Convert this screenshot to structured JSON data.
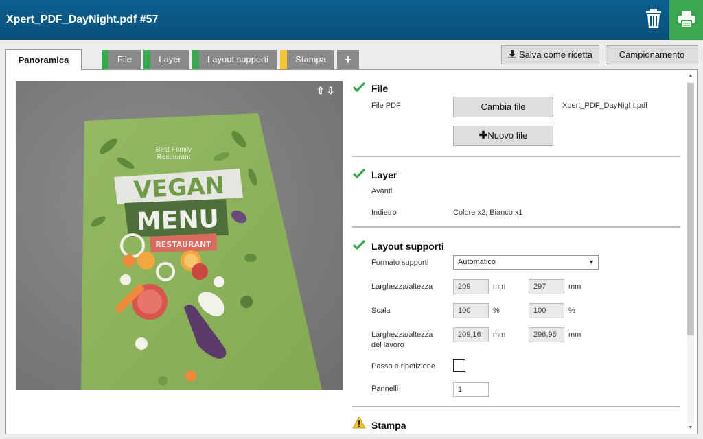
{
  "header": {
    "title": "Xpert_PDF_DayNight.pdf #57"
  },
  "tabs": [
    {
      "label": "Panoramica",
      "active": true
    },
    {
      "label": "File",
      "color": "#3aa84e"
    },
    {
      "label": "Layer",
      "color": "#3aa84e"
    },
    {
      "label": "Layout supporti",
      "color": "#3aa84e"
    },
    {
      "label": "Stampa",
      "color": "#f4c531"
    },
    {
      "label": "+"
    }
  ],
  "actions": {
    "save_recipe": "Salva come ricetta",
    "sampling": "Campionamento"
  },
  "preview": {
    "brand_line1": "Best Family",
    "brand_line2": "Restaurant",
    "word1": "VEGAN",
    "word2": "MENU",
    "word3": "RESTAURANT",
    "arrows": "⇧⇩"
  },
  "file_section": {
    "title": "File",
    "pdf_label": "File PDF",
    "change_button": "Cambia file",
    "filename": "Xpert_PDF_DayNight.pdf",
    "new_button": "Nuovo file"
  },
  "layer_section": {
    "title": "Layer",
    "front_label": "Avanti",
    "back_label": "Indietro",
    "back_value": "Colore x2, Bianco x1"
  },
  "layout_section": {
    "title": "Layout supporti",
    "format_label": "Formato supporti",
    "format_value": "Automatico",
    "size_label": "Larghezza/altezza",
    "width": "209",
    "height": "297",
    "unit_mm": "mm",
    "scale_label": "Scala",
    "scale_x": "100",
    "scale_y": "100",
    "unit_pct": "%",
    "job_size_label_1": "Larghezza/altezza",
    "job_size_label_2": "del lavoro",
    "job_width": "209,16",
    "job_height": "296,96",
    "step_repeat_label": "Passo e ripetizione",
    "panels_label": "Pannelli",
    "panels_value": "1"
  },
  "print_section": {
    "title": "Stampa"
  },
  "colors": {
    "header": "#0d5f8f",
    "ok": "#3aa84e",
    "warn": "#f4c531",
    "menu_green": "#8cb35a"
  }
}
